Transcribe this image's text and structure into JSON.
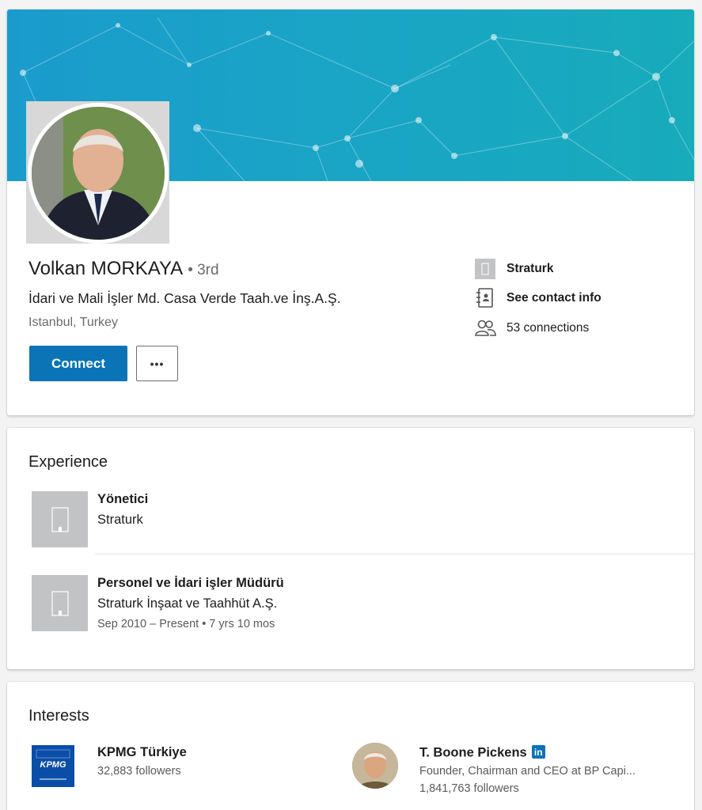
{
  "profile": {
    "name": "Volkan MORKAYA",
    "degree": "• 3rd",
    "headline": "İdari ve Mali İşler Md. Casa Verde Taah.ve İnş.A.Ş.",
    "location": "Istanbul, Turkey",
    "connect_label": "Connect",
    "more_label": "•••",
    "side": {
      "company": "Straturk",
      "contact_info": "See contact info",
      "connections": "53 connections"
    }
  },
  "experience": {
    "title": "Experience",
    "items": [
      {
        "title": "Yönetici",
        "company": "Straturk",
        "dates": ""
      },
      {
        "title": "Personel ve İdari işler Müdürü",
        "company": "Straturk İnşaat ve Taahhüt A.Ş.",
        "dates": "Sep 2010 – Present  •  7 yrs 10 mos"
      }
    ]
  },
  "interests": {
    "title": "Interests",
    "items": [
      {
        "name": "KPMG Türkiye",
        "subtitle": "32,883 followers",
        "logo_text": "KPMG"
      },
      {
        "name": "T. Boone Pickens",
        "badge": "in",
        "subtitle": "Founder, Chairman and CEO at BP Capi...",
        "followers": "1,841,763 followers"
      }
    ]
  },
  "colors": {
    "banner": "#1aa3c7",
    "primary_button": "#0a74b7",
    "kpmg_blue": "#0b4ea8"
  }
}
